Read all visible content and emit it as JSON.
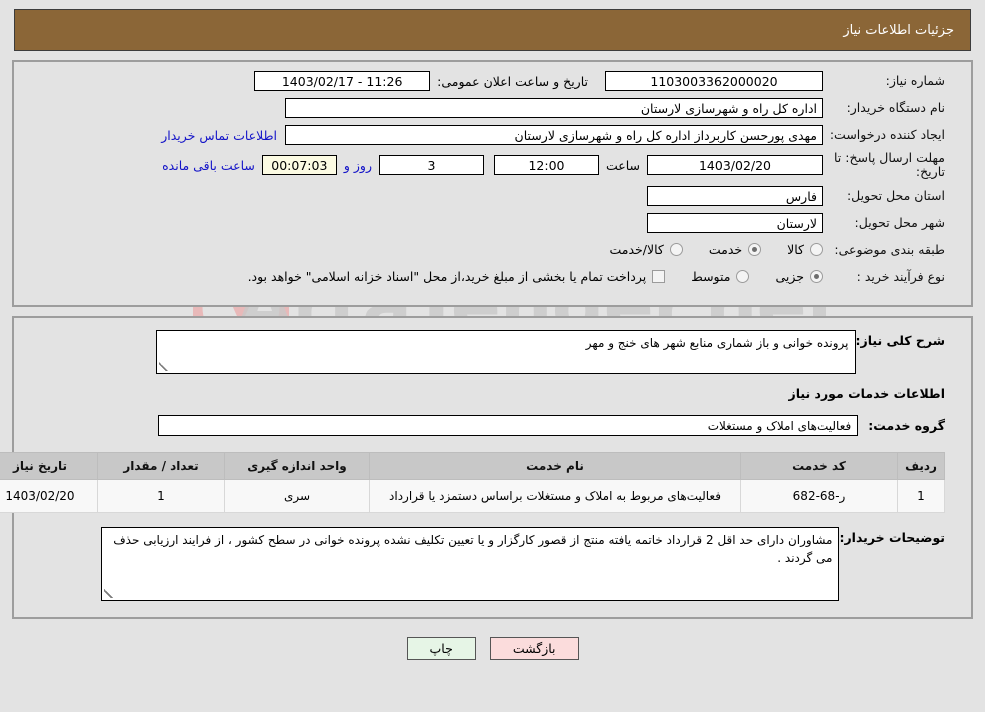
{
  "header": {
    "title": "جزئیات اطلاعات نیاز"
  },
  "watermark": {
    "text": "ArtaTender.net",
    "shield_color": "#e8b9b9",
    "text_color": "#c9c9c9"
  },
  "colors": {
    "header_bg": "#8b6637",
    "header_text": "#ffffff",
    "page_bg": "#e3e3e3",
    "link_blue": "#1414c8",
    "timer_bg": "#fcfbe3",
    "table_header_bg": "#c8c8c8",
    "btn_print_bg": "#e6f5e6",
    "btn_return_bg": "#fbdcdc"
  },
  "form": {
    "need_number": {
      "label": "شماره نیاز:",
      "value": "1103003362000020"
    },
    "public_announce": {
      "label": "تاریخ و ساعت اعلان عمومی:",
      "value": "11:26 - 1403/02/17"
    },
    "buyer_org": {
      "label": "نام دستگاه خریدار:",
      "value": "اداره کل راه و شهرسازی لارستان"
    },
    "requester": {
      "label": "ایجاد کننده درخواست:",
      "value": "مهدی  پورحسن کاربرداز اداره کل راه و شهرسازی لارستان"
    },
    "contact_link": {
      "label": "اطلاعات تماس خریدار"
    },
    "deadline": {
      "label": "مهلت ارسال پاسخ: تا تاریخ:",
      "date": "1403/02/20",
      "hour_label": "ساعت",
      "hour_value": "12:00",
      "days_value": "3",
      "days_label": "روز و",
      "timer_value": "00:07:03",
      "remaining_label": "ساعت باقی مانده"
    },
    "province": {
      "label": "استان محل تحویل:",
      "value": "فارس"
    },
    "city": {
      "label": "شهر محل تحویل:",
      "value": "لارستان"
    },
    "category": {
      "label": "طبقه بندی موضوعی:",
      "options": [
        {
          "label": "کالا",
          "selected": false
        },
        {
          "label": "خدمت",
          "selected": true
        },
        {
          "label": "کالا/خدمت",
          "selected": false
        }
      ]
    },
    "purchase_process": {
      "label": "نوع فرآیند خرید :",
      "options": [
        {
          "label": "جزیی",
          "selected": true
        },
        {
          "label": "متوسط",
          "selected": false
        }
      ],
      "checkbox_checked": false,
      "checkbox_note": "پرداخت تمام یا بخشی از مبلغ خرید،از محل \"اسناد خزانه اسلامی\" خواهد بود."
    }
  },
  "detail": {
    "general_need": {
      "label": "شرح کلی نیاز:",
      "value": "پرونده خوانی و باز شماری منابع شهر های خنج و مهر"
    },
    "section_title": "اطلاعات خدمات مورد نیاز",
    "service_group": {
      "label": "گروه خدمت:",
      "value": "فعالیت‌های  املاک و مستغلات"
    },
    "table": {
      "headers": [
        "ردیف",
        "کد خدمت",
        "نام خدمت",
        "واحد اندازه گیری",
        "تعداد / مقدار",
        "تاریخ نیاز"
      ],
      "rows": [
        {
          "row": "1",
          "code": "ر-68-682",
          "name": "فعالیت‌های مربوط به املاک و مستغلات براساس دستمزد یا قرارداد",
          "unit": "سری",
          "qty": "1",
          "date": "1403/02/20"
        }
      ]
    },
    "buyer_notes": {
      "label": "توضیحات خریدار:",
      "value": "مشاوران دارای حد اقل 2 قرارداد خاتمه یافته منتج از قصور کارگزار و یا تعیین تکلیف نشده پرونده خوانی در سطح کشور ، از فرایند ارزیابی حذف می گردند ."
    }
  },
  "footer": {
    "print_label": "چاپ",
    "return_label": "بازگشت"
  }
}
